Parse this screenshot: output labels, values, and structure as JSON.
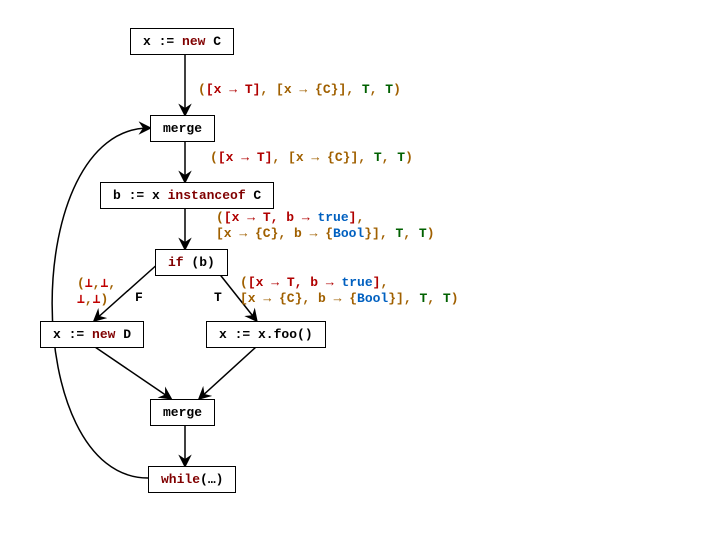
{
  "nodes": {
    "n1": {
      "pre": "x := ",
      "kw": "new",
      "post": " C"
    },
    "n2": {
      "text": "merge"
    },
    "n3": {
      "pre": "b := x ",
      "kw": "instanceof",
      "post": " C"
    },
    "n4": {
      "pre": "",
      "kw": "if",
      "post": " (b)"
    },
    "n5": {
      "pre": "x := ",
      "kw": "new",
      "post": " D"
    },
    "n6": {
      "text": "x := x.foo()"
    },
    "n7": {
      "text": "merge"
    },
    "n8": {
      "pre": "",
      "kw": "while",
      "post": "(…)"
    }
  },
  "edge_labels": {
    "eF": "F",
    "eT": "T"
  },
  "annotations": {
    "a1": {
      "parts": [
        {
          "t": "(",
          "c": "br"
        },
        {
          "t": "[x → T]",
          "c": "top1"
        },
        {
          "t": ", ",
          "c": "br"
        },
        {
          "t": "[x → {C}]",
          "c": "br"
        },
        {
          "t": ", ",
          "c": "br"
        },
        {
          "t": "T",
          "c": "top2"
        },
        {
          "t": ", ",
          "c": "br"
        },
        {
          "t": "T",
          "c": "top2"
        },
        {
          "t": ")",
          "c": "br"
        }
      ]
    },
    "a2": {
      "parts": [
        {
          "t": "(",
          "c": "br"
        },
        {
          "t": "[x → T]",
          "c": "top1"
        },
        {
          "t": ", ",
          "c": "br"
        },
        {
          "t": "[x → {C}]",
          "c": "br"
        },
        {
          "t": ", ",
          "c": "br"
        },
        {
          "t": "T",
          "c": "top2"
        },
        {
          "t": ", ",
          "c": "br"
        },
        {
          "t": "T",
          "c": "top2"
        },
        {
          "t": ")",
          "c": "br"
        }
      ]
    },
    "a3_line1": {
      "parts": [
        {
          "t": "(",
          "c": "br"
        },
        {
          "t": "[x → T,",
          "c": "top1"
        },
        {
          "t": "  ",
          "c": ""
        },
        {
          "t": "b → ",
          "c": "top1"
        },
        {
          "t": "true",
          "c": "bool"
        },
        {
          "t": "]",
          "c": "top1"
        },
        {
          "t": ",",
          "c": "br"
        }
      ]
    },
    "a3_line2": {
      "parts": [
        {
          "t": " ",
          "c": ""
        },
        {
          "t": "[x → {C}, b → {",
          "c": "br"
        },
        {
          "t": "Bool",
          "c": "bool"
        },
        {
          "t": "}]",
          "c": "br"
        },
        {
          "t": ", ",
          "c": "br"
        },
        {
          "t": "T",
          "c": "top2"
        },
        {
          "t": ", ",
          "c": "br"
        },
        {
          "t": "T",
          "c": "top2"
        },
        {
          "t": ")",
          "c": "br"
        }
      ]
    },
    "a4_line1": {
      "parts": [
        {
          "t": "(",
          "c": "br"
        },
        {
          "t": "[x → T,",
          "c": "top1"
        },
        {
          "t": "  ",
          "c": ""
        },
        {
          "t": "b → ",
          "c": "top1"
        },
        {
          "t": "true",
          "c": "bool"
        },
        {
          "t": "]",
          "c": "top1"
        },
        {
          "t": ",",
          "c": "br"
        }
      ]
    },
    "a4_line2": {
      "parts": [
        {
          "t": " ",
          "c": ""
        },
        {
          "t": "[x → {C}, b → {",
          "c": "br"
        },
        {
          "t": "Bool",
          "c": "bool"
        },
        {
          "t": "}]",
          "c": "br"
        },
        {
          "t": ", ",
          "c": "br"
        },
        {
          "t": "T",
          "c": "top2"
        },
        {
          "t": ", ",
          "c": "br"
        },
        {
          "t": "T",
          "c": "top2"
        },
        {
          "t": ")",
          "c": "br"
        }
      ]
    },
    "a5_line1": {
      "parts": [
        {
          "t": "(",
          "c": "br"
        },
        {
          "t": "⊥",
          "c": "bot"
        },
        {
          "t": ",",
          "c": "br"
        },
        {
          "t": "⊥",
          "c": "bot"
        },
        {
          "t": ",",
          "c": "br"
        }
      ]
    },
    "a5_line2": {
      "parts": [
        {
          "t": " ",
          "c": ""
        },
        {
          "t": "⊥",
          "c": "bot"
        },
        {
          "t": ",",
          "c": "br"
        },
        {
          "t": "⊥",
          "c": "bot"
        },
        {
          "t": ")",
          "c": "br"
        }
      ]
    }
  }
}
